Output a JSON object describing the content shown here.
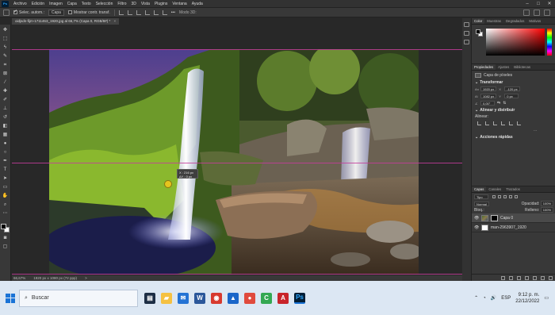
{
  "titlebar": {
    "app": "Ps",
    "menu": [
      "Archivo",
      "Edición",
      "Imagen",
      "Capa",
      "Texto",
      "Selección",
      "Filtro",
      "3D",
      "Vista",
      "Plugins",
      "Ventana",
      "Ayuda"
    ],
    "controls": [
      "–",
      "□",
      "✕"
    ]
  },
  "options": {
    "auto_select_label": "Selec. autom.:",
    "layer_select": "Capa",
    "show_transform_label": "Mostrar contr. transf.",
    "more": "•••",
    "mode3d": "Modo 3D:"
  },
  "document": {
    "tab_title": "oidjsdn-fijm-1711463_1920.jpg al 66,7% (Capa 0, RGB/8#) *",
    "tab_close": "×",
    "status_zoom": "66,67%",
    "status_size": "1920 px x 1080 px (72 ppp)",
    "status_more": ">"
  },
  "measure": {
    "x": "X : 216 px",
    "y": "ΔY : 0 px"
  },
  "color_panel": {
    "tabs": [
      "Color",
      "Muestras",
      "Degradados",
      "Motivos"
    ],
    "fg": "#000000",
    "bg": "#ffffff"
  },
  "properties": {
    "tabs": [
      "Propiedades",
      "Ajustes",
      "Bibliotecas"
    ],
    "layer_type": "Capa de píxeles",
    "transform_title": "Transformar",
    "w_label": "An",
    "w_value": "1920 px",
    "x_label": "X",
    "x_value": "-120 px",
    "h_label": "Al",
    "h_value": "1082 px",
    "y_value": "0 px",
    "angle_value": "0,00°",
    "align_title": "Alinear y distribuir",
    "align_label": "Alinear:",
    "quick_title": "Acciones rápidas",
    "more": "..."
  },
  "layers": {
    "tabs": [
      "Capas",
      "Canales",
      "Trazados"
    ],
    "filter_kind": "Tipo",
    "blend_mode": "Normal",
    "opacity_label": "Opacidad:",
    "opacity_value": "100%",
    "lock_label": "Bloq.:",
    "fill_label": "Relleno:",
    "fill_value": "100%",
    "items": [
      {
        "name": "Capa 0",
        "selected": true
      },
      {
        "name": "man-2963907_1920",
        "selected": false
      }
    ]
  },
  "taskbar": {
    "search_placeholder": "Buscar",
    "apps": [
      {
        "name": "task-view",
        "color": "#1d2e45",
        "glyph": "▤"
      },
      {
        "name": "file-explorer",
        "color": "#f5c142",
        "glyph": "▰"
      },
      {
        "name": "mail",
        "color": "#2473d4",
        "glyph": "✉"
      },
      {
        "name": "word",
        "color": "#2b579a",
        "glyph": "W"
      },
      {
        "name": "chrome",
        "color": "#d73a2f",
        "glyph": "◉"
      },
      {
        "name": "photos",
        "color": "#1a66c9",
        "glyph": "▲"
      },
      {
        "name": "snagit",
        "color": "#e04a3d",
        "glyph": "●"
      },
      {
        "name": "camtasia",
        "color": "#33a852",
        "glyph": "C"
      },
      {
        "name": "acrobat",
        "color": "#c8242b",
        "glyph": "A"
      },
      {
        "name": "photoshop",
        "color": "#001e36",
        "glyph": "Ps"
      }
    ],
    "lang": "ESP",
    "time": "9:12 p. m.",
    "date": "22/12/2022"
  }
}
